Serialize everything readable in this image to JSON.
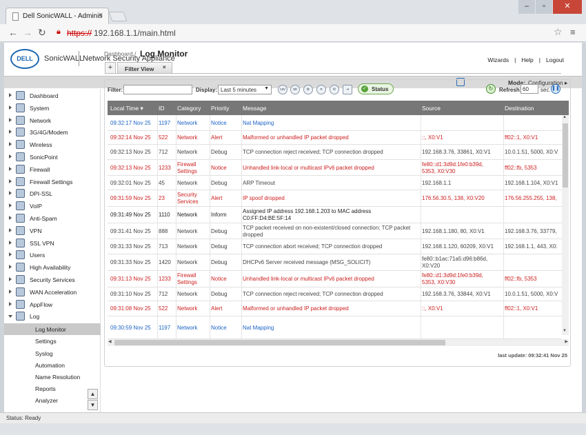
{
  "browser": {
    "tab_title": "Dell SonicWALL - Adminis",
    "tab_close": "×",
    "url_scheme": "https://",
    "url_rest": "192.168.1.1/main.html"
  },
  "header": {
    "logo": "DELL",
    "brand": "SonicWALL",
    "subtitle": "Network Security Appliance",
    "links": [
      "Wizards",
      "|",
      "Help",
      "|",
      "Logout"
    ]
  },
  "subbar": {
    "mode_label": "Mode:",
    "mode_value": "Configuration ▸"
  },
  "sidebar": {
    "items": [
      {
        "label": "Dashboard"
      },
      {
        "label": "System"
      },
      {
        "label": "Network"
      },
      {
        "label": "3G/4G/Modem"
      },
      {
        "label": "Wireless"
      },
      {
        "label": "SonicPoint"
      },
      {
        "label": "Firewall"
      },
      {
        "label": "Firewall Settings"
      },
      {
        "label": "DPI-SSL"
      },
      {
        "label": "VoIP"
      },
      {
        "label": "Anti-Spam"
      },
      {
        "label": "VPN"
      },
      {
        "label": "SSL VPN"
      },
      {
        "label": "Users"
      },
      {
        "label": "High Availability"
      },
      {
        "label": "Security Services"
      },
      {
        "label": "WAN Acceleration"
      },
      {
        "label": "AppFlow"
      },
      {
        "label": "Log"
      }
    ],
    "log_sub": [
      "Log Monitor",
      "Settings",
      "Syslog",
      "Automation",
      "Name Resolution",
      "Reports",
      "Analyzer"
    ]
  },
  "breadcrumb": "Dashboard /",
  "page_title": "Log Monitor",
  "filter_tab": {
    "plus": "+",
    "label": "Filter View",
    "close": "×"
  },
  "filterbar": {
    "filter_label": "Filter:",
    "display_label": "Display:",
    "display_value": "Last 5 minutes",
    "icons": [
      "csv",
      "txt"
    ],
    "status_label": "Status",
    "refresh_label": "Refresh:",
    "refresh_value": "60",
    "refresh_unit": "sec."
  },
  "table": {
    "columns": [
      "Local Time ▾",
      "ID",
      "Category",
      "Priority",
      "Message",
      "Source",
      "Destination"
    ],
    "rows": [
      {
        "t": "09:32:17 Nov 25",
        "id": "1197",
        "cat": [
          "Network"
        ],
        "pri": "Notice",
        "msg": [
          "Nat Mapping"
        ],
        "src": [
          ""
        ],
        "dst": [
          ""
        ],
        "tone": "blue"
      },
      {
        "t": "09:32:14 Nov 25",
        "id": "522",
        "cat": [
          "Network"
        ],
        "pri": "Alert",
        "msg": [
          "Malformed or unhandled IP packet dropped"
        ],
        "src": [
          "::, X0:V1"
        ],
        "dst": [
          "ff02::1, X0:V1"
        ],
        "tone": "red"
      },
      {
        "t": "09:32:13 Nov 25",
        "id": "712",
        "cat": [
          "Network"
        ],
        "pri": "Debug",
        "msg": [
          "TCP connection reject received; TCP connection dropped"
        ],
        "src": [
          "192.168.3.76, 33861, X0:V1"
        ],
        "dst": [
          "10.0.1.51, 5000, X0:V"
        ],
        "tone": "normal"
      },
      {
        "t": "09:32:13 Nov 25",
        "id": "1233",
        "cat": [
          "Firewall",
          "Settings"
        ],
        "pri": "Notice",
        "msg": [
          "Unhandled link-local or multicast IPv6 packet dropped"
        ],
        "src": [
          "fe80::d1:3d9d:1fe0:b39d,",
          "5353, X0:V30"
        ],
        "dst": [
          "ff02::fb, 5353"
        ],
        "tone": "red"
      },
      {
        "t": "09:32:01 Nov 25",
        "id": "45",
        "cat": [
          "Network"
        ],
        "pri": "Debug",
        "msg": [
          "ARP Timeout"
        ],
        "src": [
          "192.168.1.1"
        ],
        "dst": [
          "192.168.1.104, X0:V1"
        ],
        "tone": "normal"
      },
      {
        "t": "09:31:59 Nov 25",
        "id": "23",
        "cat": [
          "Security",
          "Services"
        ],
        "pri": "Alert",
        "msg": [
          "IP spoof dropped"
        ],
        "src": [
          "176.56.30.5, 138, X0:V20"
        ],
        "dst": [
          "176.56.255.255, 138,"
        ],
        "tone": "red"
      },
      {
        "t": "09:31:49 Nov 25",
        "id": "1110",
        "cat": [
          "Network"
        ],
        "pri": "Inform",
        "msg": [
          "Assigned IP address 192.168.1.203 to MAC address",
          "C0:FF:D4:BE:5F:14"
        ],
        "src": [
          ""
        ],
        "dst": [
          ""
        ],
        "tone": "bold"
      },
      {
        "t": "09:31:41 Nov 25",
        "id": "888",
        "cat": [
          "Network"
        ],
        "pri": "Debug",
        "msg": [
          "TCP packet received on non-existent/closed connection; TCP packet",
          "dropped"
        ],
        "src": [
          "192.168.1.180, 80, X0:V1"
        ],
        "dst": [
          "192.168.3.76, 33779,"
        ],
        "tone": "normal"
      },
      {
        "t": "09:31:33 Nov 25",
        "id": "713",
        "cat": [
          "Network"
        ],
        "pri": "Debug",
        "msg": [
          "TCP connection abort received; TCP connection dropped"
        ],
        "src": [
          "192.168.1.120, 60209, X0:V1"
        ],
        "dst": [
          "192.168.1.1, 443, X0:"
        ],
        "tone": "normal"
      },
      {
        "t": "09:31:33 Nov 25",
        "id": "1420",
        "cat": [
          "Network"
        ],
        "pri": "Debug",
        "msg": [
          "DHCPv6 Server received message (MSG_SOLICIT)"
        ],
        "src": [
          "fe80::b1ac:71a5:d96:b86d,",
          "X0:V20"
        ],
        "dst": [
          ""
        ],
        "tone": "normal"
      },
      {
        "t": "09:31:13 Nov 25",
        "id": "1233",
        "cat": [
          "Firewall",
          "Settings"
        ],
        "pri": "Notice",
        "msg": [
          "Unhandled link-local or multicast IPv6 packet dropped"
        ],
        "src": [
          "fe80::d1:3d9d:1fe0:b39d,",
          "5353, X0:V30"
        ],
        "dst": [
          "ff02::fb, 5353"
        ],
        "tone": "red"
      },
      {
        "t": "09:31:10 Nov 25",
        "id": "712",
        "cat": [
          "Network"
        ],
        "pri": "Debug",
        "msg": [
          "TCP connection reject received; TCP connection dropped"
        ],
        "src": [
          "192.168.3.76, 33844, X0:V1"
        ],
        "dst": [
          "10.0.1.51, 5000, X0:V"
        ],
        "tone": "normal"
      },
      {
        "t": "09:31:08 Nov 25",
        "id": "522",
        "cat": [
          "Network"
        ],
        "pri": "Alert",
        "msg": [
          "Malformed or unhandled IP packet dropped"
        ],
        "src": [
          "::, X0:V1"
        ],
        "dst": [
          "ff02::1, X0:V1"
        ],
        "tone": "red"
      },
      {
        "t": "09:30:59 Nov 25",
        "id": "1197",
        "cat": [
          "Network"
        ],
        "pri": "Notice",
        "msg": [
          "Nat Mapping"
        ],
        "src": [
          ""
        ],
        "dst": [
          ""
        ],
        "tone": "blue"
      }
    ]
  },
  "last_update": "last update: 09:32:41 Nov 25",
  "statusbar": "Status: Ready",
  "colors": {
    "alert_red": "#cc1e1e",
    "notice_blue": "#1c63c4",
    "header_gray": "#777777"
  }
}
